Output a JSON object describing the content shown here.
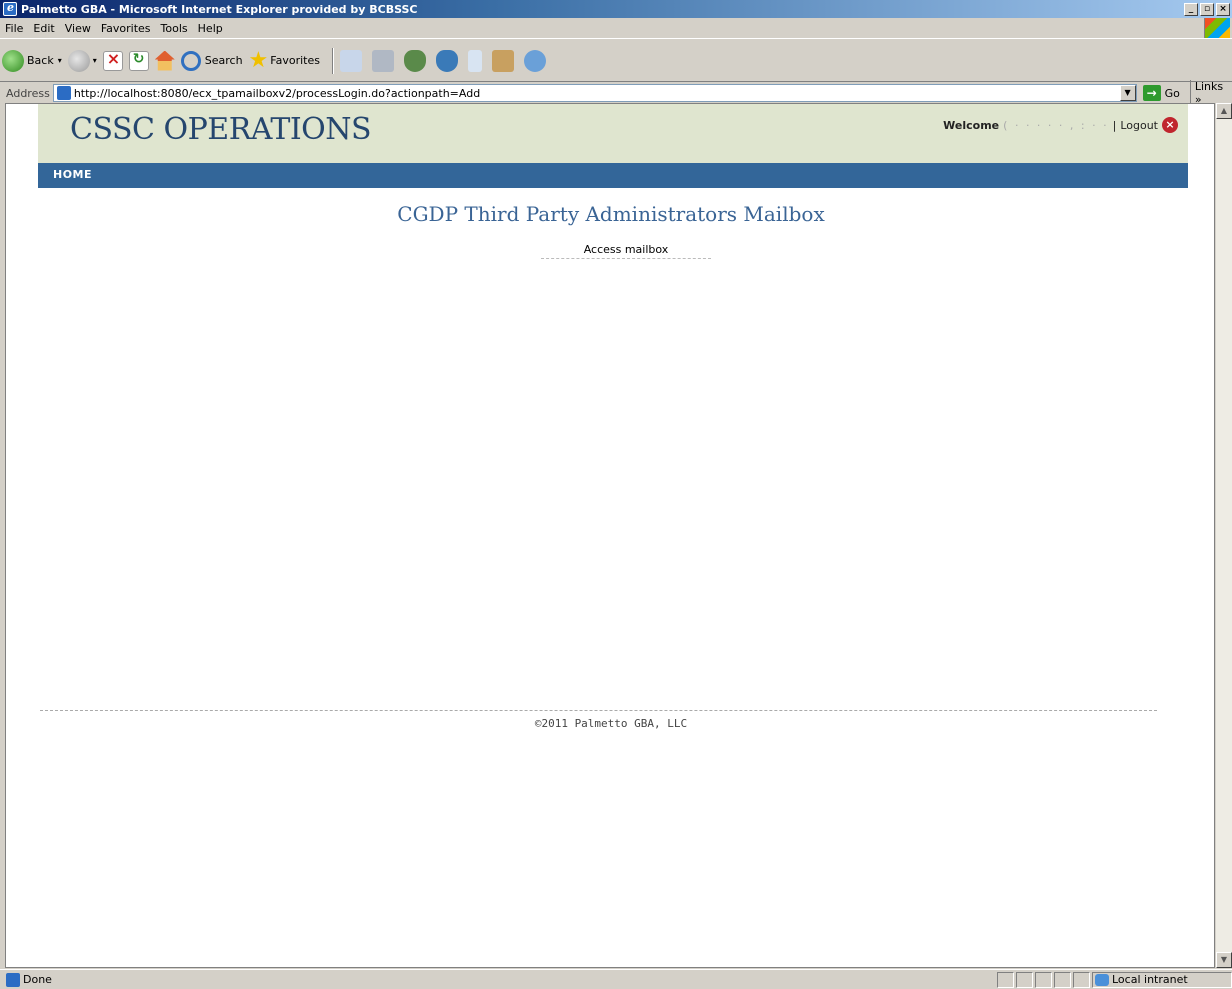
{
  "window": {
    "title": "Palmetto GBA - Microsoft Internet Explorer provided by BCBSSC",
    "controls": [
      "_",
      "▫",
      "×"
    ]
  },
  "menu": [
    "File",
    "Edit",
    "View",
    "Favorites",
    "Tools",
    "Help"
  ],
  "toolbar": {
    "back_label": "Back",
    "search_label": "Search",
    "favorites_label": "Favorites"
  },
  "address": {
    "label": "Address",
    "url": "http://localhost:8080/ecx_tpamailboxv2/processLogin.do?actionpath=Add",
    "go_label": "Go",
    "links_label": "Links »"
  },
  "site": {
    "logo": "CSSC OPERATIONS",
    "welcome_label": "Welcome",
    "welcome_name": "( · ·   · · · , : · ·",
    "separator": "|",
    "logout_label": "Logout",
    "nav_home": "HOME",
    "page_title": "CGDP Third Party Administrators Mailbox",
    "access_link": "Access mailbox",
    "footer": "©2011 Palmetto GBA, LLC"
  },
  "status": {
    "text": "Done",
    "zone": "Local intranet"
  }
}
